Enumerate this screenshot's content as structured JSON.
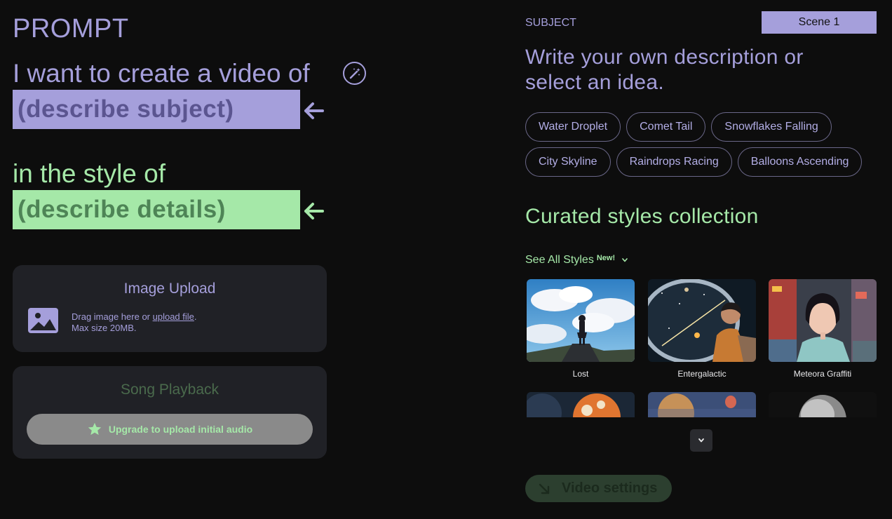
{
  "prompt": {
    "title": "PROMPT",
    "line1": "I want to create a video of",
    "subject_placeholder": "(describe subject)",
    "line2": "in the style of",
    "details_placeholder": "(describe details)"
  },
  "image_upload": {
    "title": "Image Upload",
    "text_prefix": "Drag image here or ",
    "link": "upload file",
    "text_suffix": ".",
    "max_size": "Max size 20MB."
  },
  "song_playback": {
    "title": "Song Playback",
    "upgrade_label": "Upgrade to upload initial audio"
  },
  "subject": {
    "label": "SUBJECT",
    "scene": "Scene 1",
    "heading": "Write your own description or select an idea.",
    "ideas": [
      "Water Droplet",
      "Comet Tail",
      "Snowflakes Falling",
      "City Skyline",
      "Raindrops Racing",
      "Balloons Ascending"
    ]
  },
  "styles": {
    "heading": "Curated styles collection",
    "see_all": "See All Styles",
    "new_badge": "New!",
    "items": [
      "Lost",
      "Entergalactic",
      "Meteora Graffiti",
      "",
      "",
      ""
    ]
  },
  "video_settings": "Video settings",
  "colors": {
    "purple": "#a59fdb",
    "green": "#a5e8a8",
    "card": "#202126"
  },
  "icons": [
    "magic-wand-icon",
    "arrow-left-icon",
    "image-icon",
    "star-icon",
    "chevron-down-icon",
    "arrow-down-right-icon"
  ]
}
